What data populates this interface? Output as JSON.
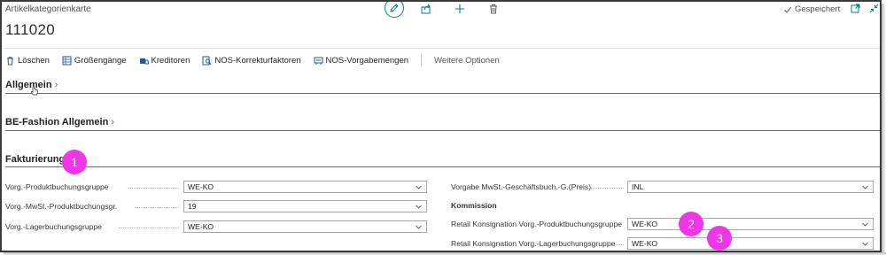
{
  "header": {
    "caption": "Artikelkategorienkarte",
    "title": "111020",
    "saved_status": "Gespeichert"
  },
  "icons": {
    "edit": "pencil-icon",
    "share": "share-icon",
    "add": "plus-icon",
    "delete": "trash-icon",
    "saved": "checkmark-icon",
    "open_new_window": "open-in-new-window-icon",
    "collapse": "collapse-icon"
  },
  "actions": [
    {
      "label": "Löschen",
      "icon": "trash-icon"
    },
    {
      "label": "Größengänge",
      "icon": "size-grid-icon"
    },
    {
      "label": "Kreditoren",
      "icon": "vendor-icon"
    },
    {
      "label": "NOS-Korrekturfaktoren",
      "icon": "search-doc-icon"
    },
    {
      "label": "NOS-Vorgabemengen",
      "icon": "quantity-icon"
    }
  ],
  "more_options": "Weitere Optionen",
  "sections": {
    "allgemein": "Allgemein",
    "be_fashion": "BE-Fashion Allgemein",
    "fakturierung": "Fakturierung"
  },
  "fields_left": [
    {
      "label": "Vorg.-Produktbuchungsgruppe",
      "value": "WE-KO"
    },
    {
      "label": "Vorg.-MwSt.-Produktbuchungsgr.",
      "value": "19"
    },
    {
      "label": "Vorg.-Lagerbuchungsgruppe",
      "value": "WE-KO"
    }
  ],
  "fields_right": {
    "vorgabe": {
      "label": "Vorgabe MwSt.-Geschäftsbuch.-G.(Preis)",
      "value": "INL"
    },
    "kommission_heading": "Kommission",
    "retail_prod": {
      "label": "Retail Konsignation Vorg.-Produktbuchungsgruppe",
      "value": "WE-KO"
    },
    "retail_lager": {
      "label": "Retail Konsignation Vorg.-Lagerbuchungsgruppe",
      "value": "WE-KO"
    }
  },
  "annotations": [
    "1",
    "2",
    "3"
  ],
  "colors": {
    "accent": "#00827f",
    "badge": "#f035e8",
    "action_icon": "#1e5aa6"
  }
}
